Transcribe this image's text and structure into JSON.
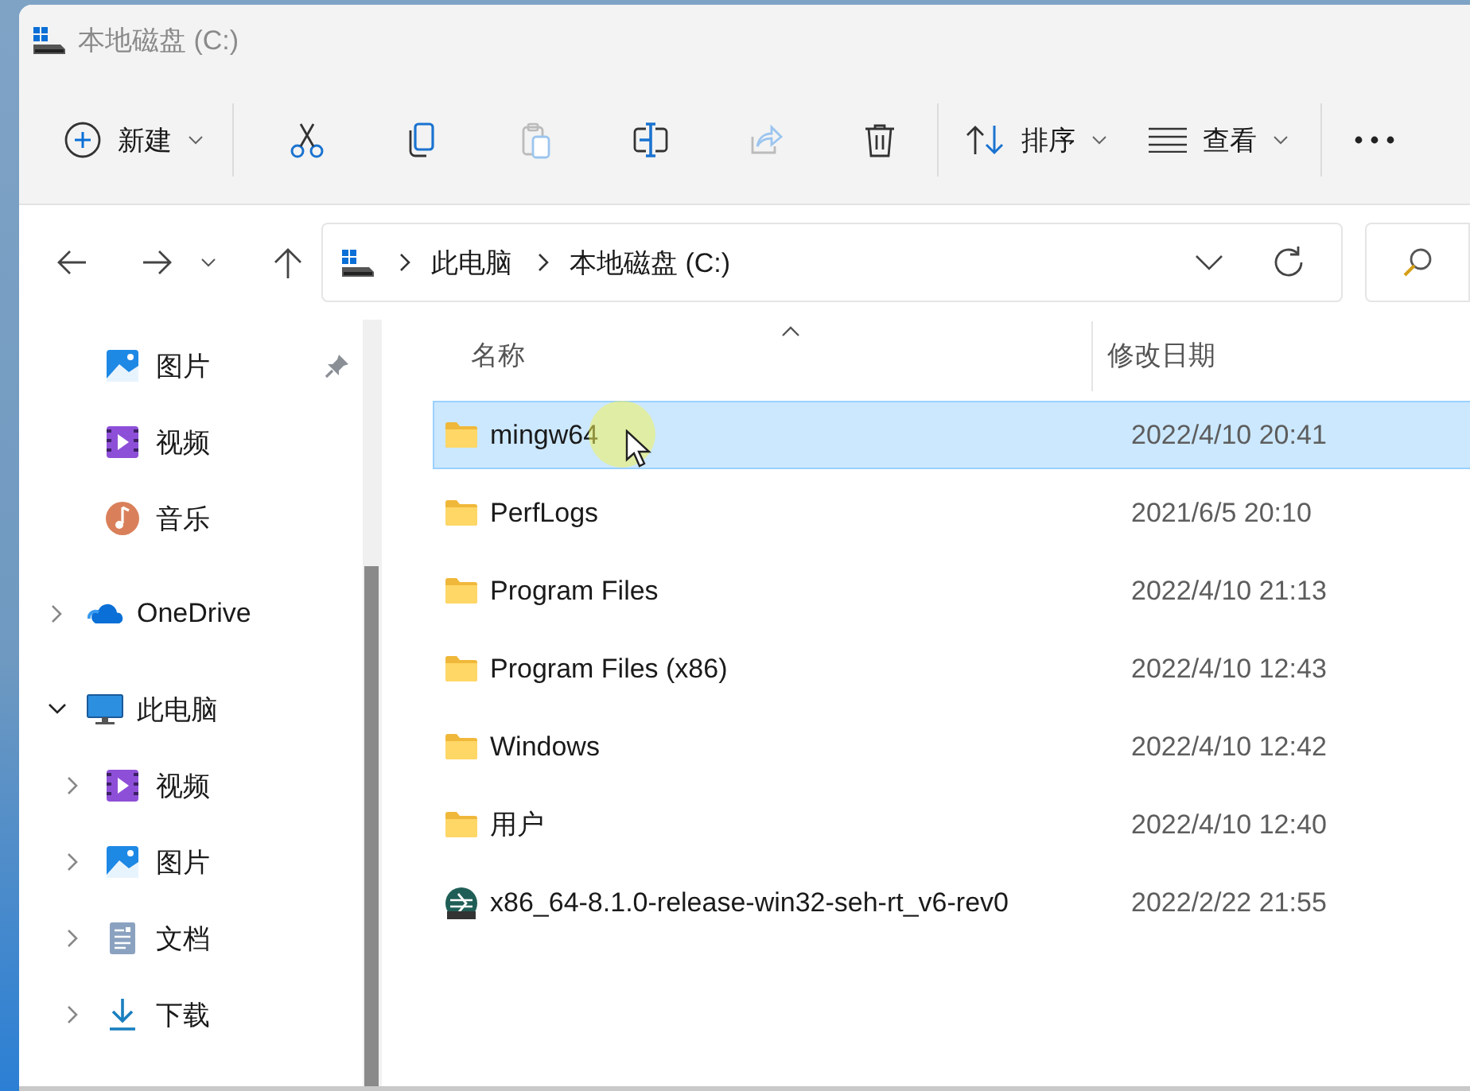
{
  "window": {
    "title": "本地磁盘 (C:)"
  },
  "toolbar": {
    "new": {
      "label": "新建"
    },
    "actions": [
      {
        "kind": "cut",
        "disabled": false
      },
      {
        "kind": "copy",
        "disabled": false
      },
      {
        "kind": "paste",
        "disabled": true
      },
      {
        "kind": "rename",
        "disabled": false
      },
      {
        "kind": "share",
        "disabled": true
      },
      {
        "kind": "delete",
        "disabled": false
      }
    ],
    "sort": {
      "label": "排序"
    },
    "view": {
      "label": "查看"
    }
  },
  "address_bar": {
    "path": [
      "此电脑",
      "本地磁盘 (C:)"
    ]
  },
  "sidebar": {
    "items": [
      {
        "label": "图片",
        "kind": "pictures",
        "pinned": true
      },
      {
        "label": "视频",
        "kind": "videos",
        "pinned": false
      },
      {
        "label": "音乐",
        "kind": "music",
        "pinned": false
      },
      {
        "label": "OneDrive",
        "kind": "onedrive",
        "expanded": false
      },
      {
        "label": "此电脑",
        "kind": "pc",
        "expanded": true,
        "children": [
          {
            "label": "视频",
            "kind": "videos",
            "expanded": false
          },
          {
            "label": "图片",
            "kind": "pictures",
            "expanded": false
          },
          {
            "label": "文档",
            "kind": "documents",
            "expanded": false
          },
          {
            "label": "下载",
            "kind": "downloads",
            "expanded": false
          }
        ]
      }
    ]
  },
  "table": {
    "columns": [
      "名称",
      "修改日期"
    ],
    "rows": [
      {
        "name": "mingw64",
        "modified": "2022/4/10 20:41",
        "kind": "folder",
        "selected": true
      },
      {
        "name": "PerfLogs",
        "modified": "2021/6/5 20:10",
        "kind": "folder",
        "selected": false
      },
      {
        "name": "Program Files",
        "modified": "2022/4/10 21:13",
        "kind": "folder",
        "selected": false
      },
      {
        "name": "Program Files (x86)",
        "modified": "2022/4/10 12:43",
        "kind": "folder",
        "selected": false
      },
      {
        "name": "Windows",
        "modified": "2022/4/10 12:42",
        "kind": "folder",
        "selected": false
      },
      {
        "name": "用户",
        "modified": "2022/4/10 12:40",
        "kind": "folder",
        "selected": false
      },
      {
        "name": "x86_64-8.1.0-release-win32-seh-rt_v6-rev0",
        "modified": "2022/2/22 21:55",
        "kind": "archive",
        "selected": false
      }
    ]
  }
}
